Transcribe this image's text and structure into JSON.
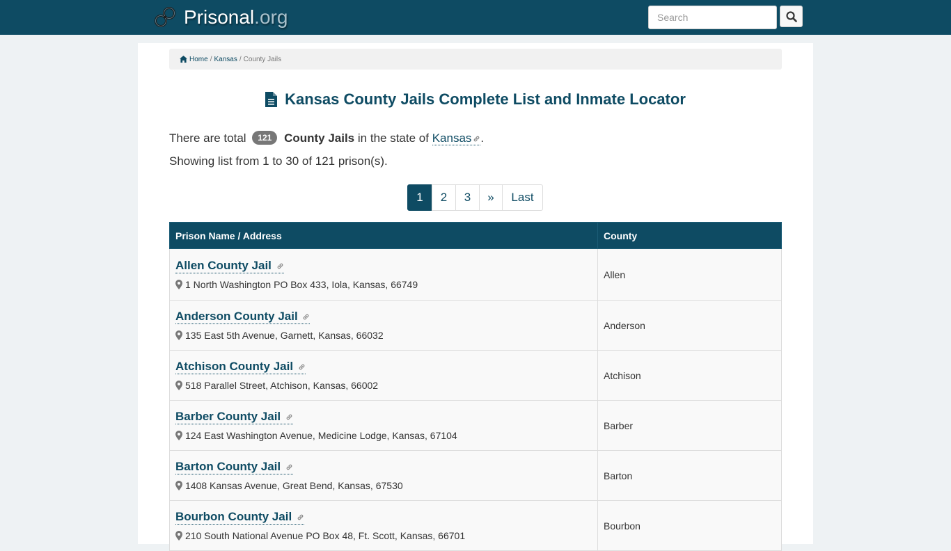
{
  "header": {
    "brand_name": "Prisonal",
    "brand_tld": ".org",
    "search_placeholder": "Search"
  },
  "breadcrumb": {
    "home": "Home",
    "state": "Kansas",
    "current": "County Jails"
  },
  "page": {
    "title": "Kansas County Jails Complete List and Inmate Locator",
    "summary_prefix": "There are total",
    "count": "121",
    "summary_type": "County Jails",
    "summary_mid": "in the state of",
    "state_name": "Kansas",
    "summary_end": ".",
    "showing": "Showing list from 1 to 30 of 121 prison(s)."
  },
  "pagination": [
    "1",
    "2",
    "3",
    "»",
    "Last"
  ],
  "table": {
    "headers": [
      "Prison Name / Address",
      "County"
    ],
    "rows": [
      {
        "name": "Allen County Jail",
        "address": "1 North Washington PO Box 433, Iola, Kansas, 66749",
        "county": "Allen"
      },
      {
        "name": "Anderson County Jail",
        "address": "135 East 5th Avenue, Garnett, Kansas, 66032",
        "county": "Anderson"
      },
      {
        "name": "Atchison County Jail",
        "address": "518 Parallel Street, Atchison, Kansas, 66002",
        "county": "Atchison"
      },
      {
        "name": "Barber County Jail",
        "address": "124 East Washington Avenue, Medicine Lodge, Kansas, 67104",
        "county": "Barber"
      },
      {
        "name": "Barton County Jail",
        "address": "1408 Kansas Avenue, Great Bend, Kansas, 67530",
        "county": "Barton"
      },
      {
        "name": "Bourbon County Jail",
        "address": "210 South National Avenue PO Box 48, Ft. Scott, Kansas, 66701",
        "county": "Bourbon"
      }
    ]
  },
  "colors": {
    "brand": "#0e4b63",
    "background": "#eef2f4",
    "badge": "#777777"
  }
}
